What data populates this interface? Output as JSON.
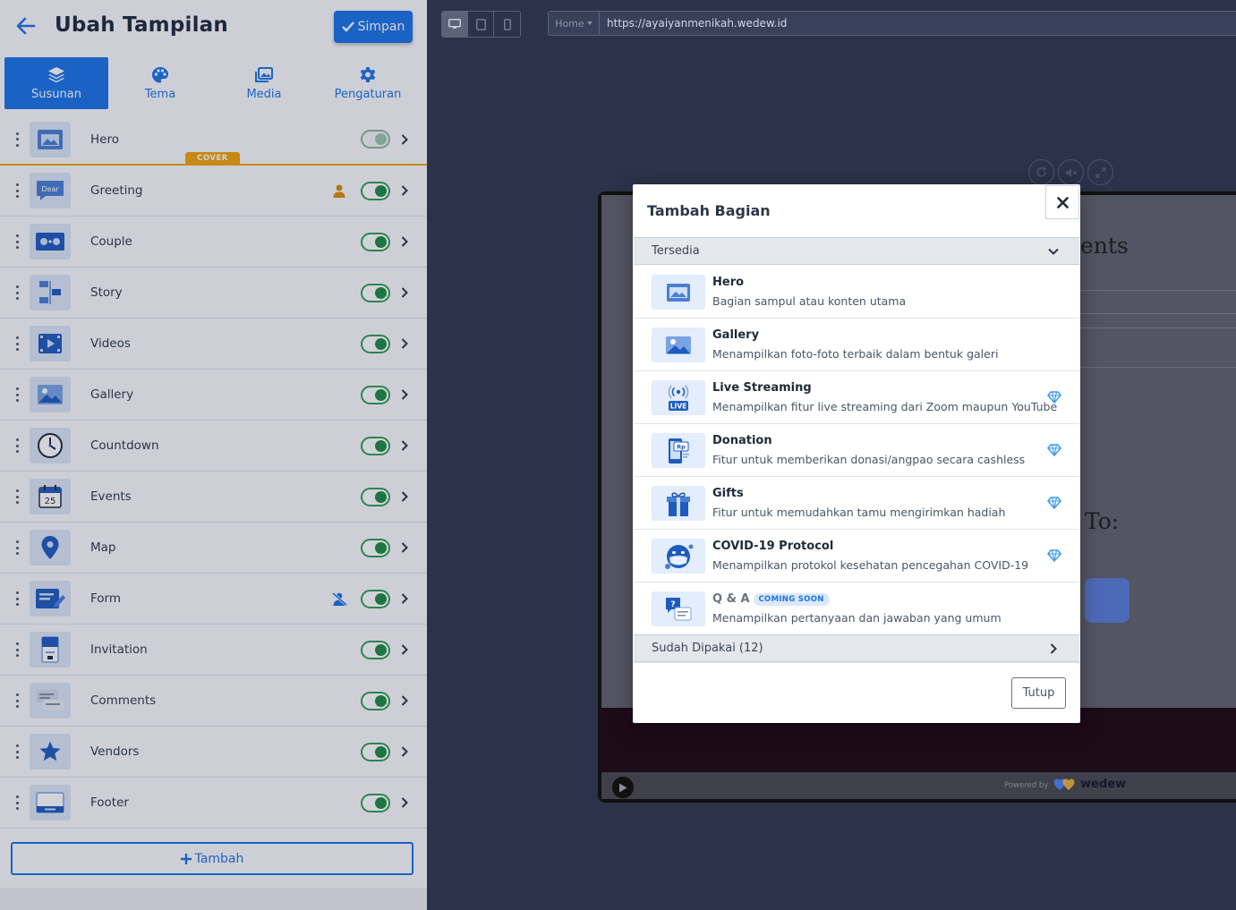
{
  "sidebar": {
    "title": "Ubah Tampilan",
    "save_label": "Simpan",
    "tabs": [
      {
        "label": "Susunan",
        "icon": "layers-icon",
        "active": true
      },
      {
        "label": "Tema",
        "icon": "palette-icon",
        "active": false
      },
      {
        "label": "Media",
        "icon": "images-icon",
        "active": false
      },
      {
        "label": "Pengaturan",
        "icon": "gear-icon",
        "active": false
      }
    ],
    "cover_badge": "COVER",
    "sections": [
      {
        "label": "Hero",
        "enabled": true
      },
      {
        "label": "Greeting",
        "enabled": true,
        "thumb_text": "Dear"
      },
      {
        "label": "Couple",
        "enabled": true
      },
      {
        "label": "Story",
        "enabled": true
      },
      {
        "label": "Videos",
        "enabled": true
      },
      {
        "label": "Gallery",
        "enabled": true
      },
      {
        "label": "Countdown",
        "enabled": true
      },
      {
        "label": "Events",
        "enabled": true,
        "thumb_text": "25"
      },
      {
        "label": "Map",
        "enabled": true
      },
      {
        "label": "Form",
        "enabled": true
      },
      {
        "label": "Invitation",
        "enabled": true
      },
      {
        "label": "Comments",
        "enabled": true
      },
      {
        "label": "Vendors",
        "enabled": true
      },
      {
        "label": "Footer",
        "enabled": true
      }
    ],
    "add_label": "Tambah"
  },
  "preview": {
    "page_select": "Home",
    "url": "https://ayaiyanmenikah.wedew.id",
    "events_fragment": "ents",
    "to_fragment": "To:",
    "powered_by": "Powered by",
    "brand": "wedew"
  },
  "modal": {
    "title": "Tambah Bagian",
    "available_label": "Tersedia",
    "used_label": "Sudah Dipakai (12)",
    "close_label": "Tutup",
    "coming_soon": "COMING SOON",
    "items": [
      {
        "name": "Hero",
        "desc": "Bagian sampul atau konten utama",
        "premium": false
      },
      {
        "name": "Gallery",
        "desc": "Menampilkan foto-foto terbaik dalam bentuk galeri",
        "premium": false
      },
      {
        "name": "Live Streaming",
        "desc": "Menampilkan fitur live streaming dari Zoom maupun YouTube",
        "premium": true,
        "thumb_text": "LIVE"
      },
      {
        "name": "Donation",
        "desc": "Fitur untuk memberikan donasi/angpao secara cashless",
        "premium": true,
        "thumb_text": "Rp"
      },
      {
        "name": "Gifts",
        "desc": "Fitur untuk memudahkan tamu mengirimkan hadiah",
        "premium": true
      },
      {
        "name": "COVID-19 Protocol",
        "desc": "Menampilkan protokol kesehatan pencegahan COVID-19",
        "premium": true
      },
      {
        "name": "Q & A",
        "desc": "Menampilkan pertanyaan dan jawaban yang umum",
        "premium": false
      }
    ]
  },
  "colors": {
    "accent": "#1a73e8",
    "cover": "#f0a30a",
    "toggle_on": "#1e8a44",
    "premium": "#3b9bf0"
  }
}
